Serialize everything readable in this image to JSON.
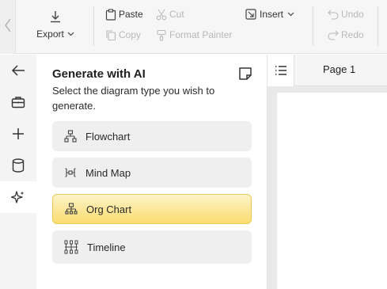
{
  "toolbar": {
    "export_label": "Export",
    "paste_label": "Paste",
    "copy_label": "Copy",
    "cut_label": "Cut",
    "format_painter_label": "Format Painter",
    "insert_label": "Insert",
    "undo_label": "Undo",
    "redo_label": "Redo"
  },
  "rail": {
    "items": [
      {
        "icon": "back-arrow-icon",
        "active": false
      },
      {
        "icon": "briefcase-icon",
        "active": false
      },
      {
        "icon": "plus-icon",
        "active": false
      },
      {
        "icon": "database-icon",
        "active": false
      },
      {
        "icon": "sparkle-icon",
        "active": true
      }
    ]
  },
  "panel": {
    "title": "Generate with AI",
    "description": "Select the diagram type you wish to generate.",
    "options": [
      {
        "label": "Flowchart",
        "icon": "flowchart-icon",
        "selected": false
      },
      {
        "label": "Mind Map",
        "icon": "mind-map-icon",
        "selected": false
      },
      {
        "label": "Org Chart",
        "icon": "org-chart-icon",
        "selected": true
      },
      {
        "label": "Timeline",
        "icon": "timeline-icon",
        "selected": false
      }
    ]
  },
  "canvas": {
    "page_tab": "Page 1"
  },
  "colors": {
    "selected_gradient_top": "#fdf3c9",
    "selected_gradient_bottom": "#fbdc6e",
    "selected_border": "#eacb58"
  }
}
